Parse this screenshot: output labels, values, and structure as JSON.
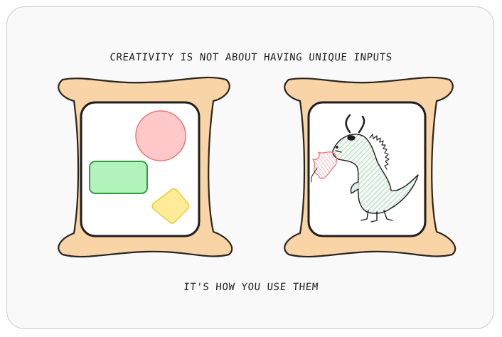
{
  "headline": "CREATIVITY IS NOT ABOUT HAVING UNIQUE INPUTS",
  "subline": "IT'S HOW YOU USE THEM",
  "colors": {
    "frame_fill": "#f8d4a6",
    "frame_stroke": "#2a2420",
    "panel_fill": "#ffffff",
    "circle_fill": "#ffc9c9",
    "circle_stroke": "#e8777a",
    "rect_fill": "#b2f2bb",
    "rect_stroke": "#2f9e44",
    "diamond_fill": "#ffec99",
    "diamond_stroke": "#f0c93a",
    "dragon_fill": "#dceee0",
    "dragon_hatch": "#6aab7c",
    "flame_stroke": "#e8777a"
  },
  "icons": {
    "left_frame": "bone-frame",
    "right_frame": "bone-frame",
    "dragon": "dragon-icon"
  }
}
